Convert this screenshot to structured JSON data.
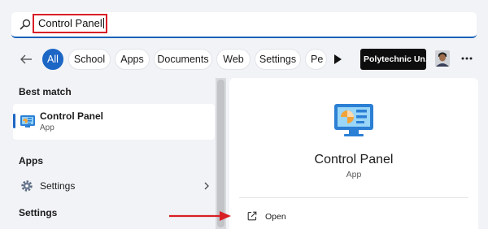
{
  "search": {
    "query": "Control Panel",
    "accent_color": "#1a63b8",
    "highlight_color": "#d81f26"
  },
  "filters": {
    "back_icon": "back-arrow-icon",
    "chips": [
      "All",
      "School",
      "Apps",
      "Documents",
      "Web",
      "Settings",
      "Pe"
    ],
    "active_chip": "All",
    "active_color": "#1c66c5",
    "org_label": "Polytechnic Un...",
    "more_icon": "ellipsis-icon"
  },
  "results": {
    "best_match_heading": "Best match",
    "best_match": {
      "title": "Control Panel",
      "subtitle": "App",
      "icon": "control-panel-icon"
    },
    "apps_heading": "Apps",
    "apps": [
      {
        "label": "Settings",
        "icon": "gear-icon"
      }
    ],
    "settings_heading": "Settings"
  },
  "detail": {
    "title": "Control Panel",
    "subtitle": "App",
    "actions": [
      {
        "label": "Open",
        "icon": "open-external-icon"
      }
    ]
  },
  "annotation": {
    "arrow_color": "#d81f26"
  }
}
